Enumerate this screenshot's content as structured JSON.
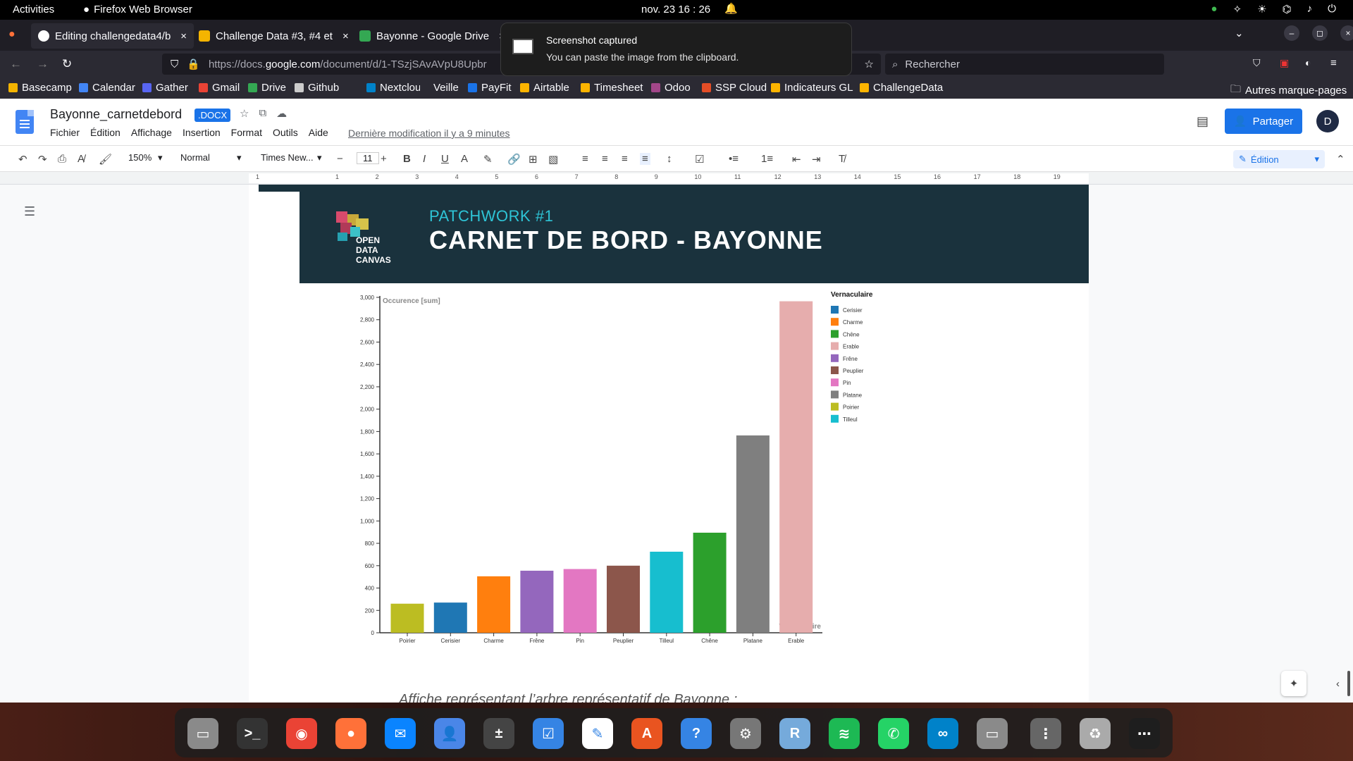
{
  "topbar": {
    "activities": "Activities",
    "app_name": "Firefox Web Browser",
    "clock": "nov. 23  16 : 26"
  },
  "tabs": [
    {
      "label": "Editing challengedata4/b"
    },
    {
      "label": "Challenge Data #3, #4 et"
    },
    {
      "label": "Bayonne - Google Drive"
    }
  ],
  "notification": {
    "title": "Screenshot captured",
    "body": "You can paste the image from the clipboard."
  },
  "navbar": {
    "url_prefix": "https://docs.",
    "url_domain": "google.com",
    "url_path": "/document/d/1-TSzjSAvAVpU8Upbr",
    "search_placeholder": "Rechercher"
  },
  "bookmarks": [
    {
      "label": "Basecamp",
      "color": "#f4b400"
    },
    {
      "label": "Calendar",
      "color": "#4285f4"
    },
    {
      "label": "Gather",
      "color": "#5865f2"
    },
    {
      "label": "Gmail",
      "color": "#ea4335"
    },
    {
      "label": "Drive",
      "color": "#34a853"
    },
    {
      "label": "Github",
      "color": "#cccccc"
    },
    {
      "label": "Nextcloud",
      "color": "#0082c9"
    },
    {
      "label": "Veille",
      "color": "#2b2a33"
    },
    {
      "label": "PayFit",
      "color": "#1a73e8"
    },
    {
      "label": "Airtable",
      "color": "#fcb400"
    },
    {
      "label": "Timesheet",
      "color": "#fcb400"
    },
    {
      "label": "Odoo",
      "color": "#a24689"
    },
    {
      "label": "SSP Cloud",
      "color": "#e44d26"
    },
    {
      "label": "Indicateurs GL",
      "color": "#fcb400"
    },
    {
      "label": "ChallengeData",
      "color": "#fcb400"
    }
  ],
  "bookmarks_other": "Autres marque-pages",
  "doc": {
    "title": "Bayonne_carnetdebord",
    "badge": ".DOCX",
    "menus": [
      "Fichier",
      "Édition",
      "Affichage",
      "Insertion",
      "Format",
      "Outils",
      "Aide"
    ],
    "last_modified": "Dernière modification il y a 9 minutes",
    "share_label": "Partager",
    "avatar": "D"
  },
  "toolbar": {
    "zoom": "150%",
    "style": "Normal",
    "font": "Times New...",
    "size": "11",
    "mode": "Édition"
  },
  "ruler": [
    "1",
    "1",
    "2",
    "3",
    "4",
    "5",
    "6",
    "7",
    "8",
    "9",
    "10",
    "11",
    "12",
    "13",
    "14",
    "15",
    "16",
    "17",
    "18",
    "19"
  ],
  "banner": {
    "subtitle": "PATCHWORK #1",
    "title": "CARNET DE BORD - BAYONNE",
    "logo_text": "OPEN DATA CANVAS"
  },
  "chart_data": {
    "type": "bar",
    "categories": [
      "Poirier",
      "Cerisier",
      "Charme",
      "Frêne",
      "Pin",
      "Peuplier",
      "Tilleul",
      "Chêne",
      "Platane",
      "Erable"
    ],
    "values": [
      260,
      270,
      505,
      555,
      570,
      600,
      725,
      895,
      1765,
      2965
    ],
    "colors": [
      "#bcbd22",
      "#1f77b4",
      "#ff7f0e",
      "#9467bd",
      "#e377c2",
      "#8c564b",
      "#17becf",
      "#2ca02c",
      "#7f7f7f",
      "#e6adad"
    ],
    "ylabel": "Occurence [sum]",
    "xlabel": "Vernaculaire",
    "ylim": [
      0,
      3000
    ],
    "yticks": [
      "0",
      "200",
      "400",
      "600",
      "800",
      "1,000",
      "1,200",
      "1,400",
      "1,600",
      "1,800",
      "2,000",
      "2,200",
      "2,400",
      "2,600",
      "2,800",
      "3,000"
    ],
    "legend_title": "Vernaculaire",
    "legend": [
      {
        "name": "Cerisier",
        "color": "#1f77b4"
      },
      {
        "name": "Charme",
        "color": "#ff7f0e"
      },
      {
        "name": "Chêne",
        "color": "#2ca02c"
      },
      {
        "name": "Erable",
        "color": "#e6adad"
      },
      {
        "name": "Frêne",
        "color": "#9467bd"
      },
      {
        "name": "Peuplier",
        "color": "#8c564b"
      },
      {
        "name": "Pin",
        "color": "#e377c2"
      },
      {
        "name": "Platane",
        "color": "#7f7f7f"
      },
      {
        "name": "Poirier",
        "color": "#bcbd22"
      },
      {
        "name": "Tilleul",
        "color": "#17becf"
      }
    ],
    "grid": false,
    "legend_position": "right"
  },
  "doc_bottom_text": "Affiche représentant l’arbre représentatif de Bayonne :",
  "dock": [
    {
      "name": "files",
      "color": "#8a8a8a"
    },
    {
      "name": "terminal",
      "color": "#333333"
    },
    {
      "name": "chrome",
      "color": "#ea4335"
    },
    {
      "name": "firefox",
      "color": "#ff7139"
    },
    {
      "name": "thunderbird",
      "color": "#0a84ff"
    },
    {
      "name": "contacts",
      "color": "#4a86e8"
    },
    {
      "name": "calculator",
      "color": "#444444"
    },
    {
      "name": "tasks",
      "color": "#3584e4"
    },
    {
      "name": "text-editor",
      "color": "#ffffff"
    },
    {
      "name": "app-store",
      "color": "#e95420"
    },
    {
      "name": "help",
      "color": "#3584e4"
    },
    {
      "name": "settings",
      "color": "#777777"
    },
    {
      "name": "r-studio",
      "color": "#75aadb"
    },
    {
      "name": "spotify",
      "color": "#1db954"
    },
    {
      "name": "whatsapp",
      "color": "#25d366"
    },
    {
      "name": "nextcloud",
      "color": "#0082c9"
    },
    {
      "name": "files-2",
      "color": "#8a8a8a"
    },
    {
      "name": "archive",
      "color": "#666666"
    },
    {
      "name": "trash",
      "color": "#aaaaaa"
    },
    {
      "name": "app-grid",
      "color": "#1e1e1e"
    }
  ]
}
